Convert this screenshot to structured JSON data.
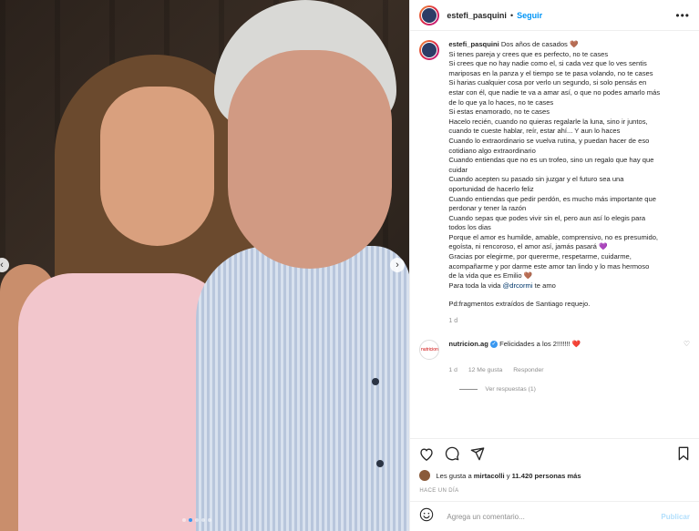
{
  "header": {
    "username": "estefi_pasquini",
    "separator": "•",
    "follow_label": "Seguir",
    "more_icon": "•••"
  },
  "caption": {
    "username": "estefi_pasquini",
    "first_line": "Dos años de casados 🤎",
    "lines": [
      "Si tenes pareja y crees que es perfecto, no te cases",
      "Si crees que no hay nadie como el, si cada vez que lo ves sentis",
      "mariposas en la panza y el tiempo se te pasa volando, no te cases",
      "Si harias cualquier cosa por verlo un segundo, si solo pensás en",
      "estar con él, que nadie te va a amar así, o que no podes amarlo más",
      "de lo que ya lo haces, no te cases",
      "Si estas enamorado, no te cases",
      "Hacelo recién, cuando no quieras regalarle la luna, sino ir juntos,",
      "cuando te cueste hablar, reír, estar ahí... Y aun lo haces",
      "Cuando lo extraordinario se vuelva rutina, y puedan hacer de eso",
      "cotidiano algo extraordinario",
      "Cuando entiendas que no es un trofeo, sino un regalo que hay que",
      "cuidar",
      "Cuando acepten su pasado sin juzgar y el futuro sea una",
      "oportunidad de hacerlo feliz",
      "Cuando entiendas que pedir perdón, es mucho más importante que",
      "perdonar y tener la razón",
      "Cuando sepas que podes vivir sin el, pero aun así lo elegis para",
      "todos los dias",
      "Porque el amor es humilde, amable, comprensivo, no es presumido,",
      "egoísta, ni rencoroso, el amor así, jamás pasará 💜",
      "Gracias por elegirme, por quererme, respetarme, cuidarme,",
      "acompañarme y por darme este amor tan lindo y lo mas hermoso",
      "de la vida que es Emilio 🤎"
    ],
    "last_line_prefix": "Para toda la vida ",
    "mention": "@drcormi",
    "last_line_suffix": " te amo",
    "footer": "Pd:fragmentos extraídos de Santiago requejo.",
    "time": "1 d"
  },
  "reply": {
    "avatar_text": "nutricion",
    "username": "nutricion.ag",
    "verified_icon": "✓",
    "text": "Felicidades a los 2!!!!!!! ❤️",
    "like_icon": "♡",
    "time": "1 d",
    "likes": "12 Me gusta",
    "reply_label": "Responder",
    "view_replies": "Ver respuestas (1)"
  },
  "likes": {
    "prefix": "Les gusta a ",
    "user": "mirtacolli",
    "middle": " y ",
    "count": "11.420 personas más"
  },
  "age": "HACE UN DÍA",
  "comment": {
    "placeholder": "Agrega un comentario...",
    "publish": "Publicar"
  },
  "nav": {
    "prev_icon": "‹",
    "next_icon": "›"
  },
  "colors": {
    "follow": "#0095f6",
    "publish_disabled": "#b2dffc",
    "like_red": "#ed4956",
    "carousel_active": "#3897f0"
  }
}
